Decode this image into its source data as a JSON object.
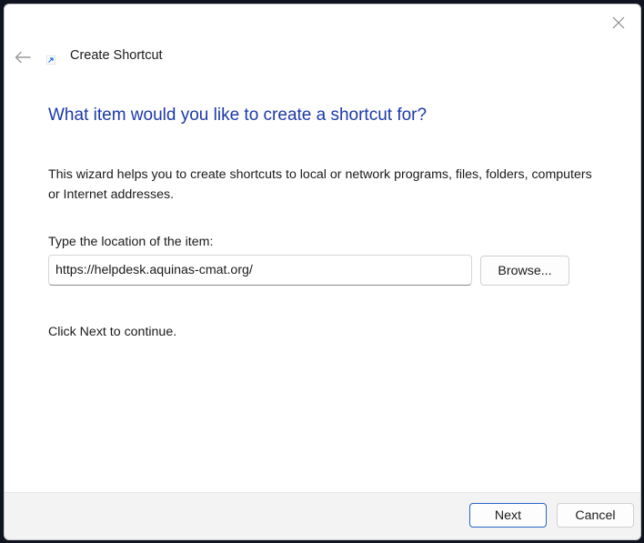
{
  "window": {
    "title": "Create Shortcut"
  },
  "wizard": {
    "heading": "What item would you like to create a shortcut for?",
    "intro": "This wizard helps you to create shortcuts to local or network programs, files, folders, computers or Internet addresses.",
    "location_label": "Type the location of the item:",
    "location_value": "https://helpdesk.aquinas-cmat.org/",
    "browse_label": "Browse...",
    "continue_text": "Click Next to continue."
  },
  "footer": {
    "next_label": "Next",
    "cancel_label": "Cancel"
  },
  "icons": {
    "close": "close-icon",
    "back": "back-arrow-icon",
    "shortcut": "shortcut-arrow-icon"
  },
  "colors": {
    "heading": "#1c3aa9",
    "primary_border": "#2a64c8",
    "footer_bg": "#f3f3f3"
  }
}
